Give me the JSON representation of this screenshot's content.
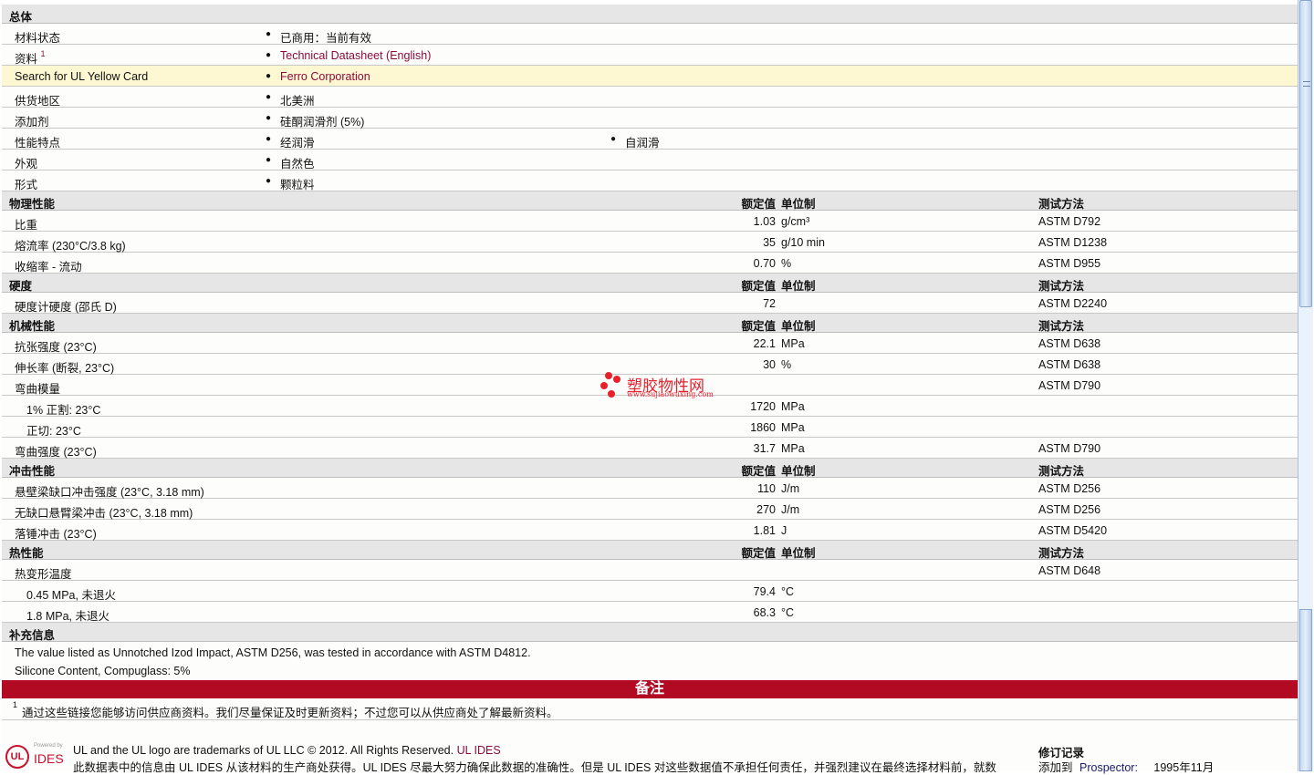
{
  "general": {
    "title": "总体",
    "rows": [
      {
        "label": "材料状态",
        "values": [
          "已商用：当前有效"
        ]
      },
      {
        "label": "资料",
        "sup": "1",
        "values": [
          "Technical Datasheet (English)"
        ],
        "link": true
      },
      {
        "label": "Search for UL Yellow Card",
        "values": [
          "Ferro Corporation"
        ],
        "link": true,
        "highlight": true
      },
      {
        "label": "供货地区",
        "values": [
          "北美洲"
        ]
      },
      {
        "label": "添加剂",
        "values": [
          "硅酮润滑剂 (5%)"
        ]
      },
      {
        "label": "性能特点",
        "values": [
          "经润滑",
          "自润滑"
        ]
      },
      {
        "label": "外观",
        "values": [
          "自然色"
        ]
      },
      {
        "label": "形式",
        "values": [
          "颗粒料"
        ]
      }
    ]
  },
  "col_headers": {
    "value": "额定值",
    "unit": "单位制",
    "method": "测试方法"
  },
  "sections": [
    {
      "title": "物理性能",
      "rows": [
        {
          "label": "比重",
          "value": "1.03",
          "unit": "g/cm³",
          "method": "ASTM D792"
        },
        {
          "label": "熔流率 (230°C/3.8 kg)",
          "value": "35",
          "unit": "g/10 min",
          "method": "ASTM D1238"
        },
        {
          "label": "收缩率 - 流动",
          "value": "0.70",
          "unit": "%",
          "method": "ASTM D955"
        }
      ]
    },
    {
      "title": "硬度",
      "rows": [
        {
          "label": "硬度计硬度 (邵氏 D)",
          "value": "72",
          "unit": "",
          "method": "ASTM D2240"
        }
      ]
    },
    {
      "title": "机械性能",
      "rows": [
        {
          "label": "抗张强度 (23°C)",
          "value": "22.1",
          "unit": "MPa",
          "method": "ASTM D638"
        },
        {
          "label": "伸长率 (断裂, 23°C)",
          "value": "30",
          "unit": "%",
          "method": "ASTM D638"
        },
        {
          "label": "弯曲模量",
          "value": "",
          "unit": "",
          "method": "ASTM D790"
        },
        {
          "label": "1% 正割: 23°C",
          "indent": true,
          "value": "1720",
          "unit": "MPa",
          "method": ""
        },
        {
          "label": "正切: 23°C",
          "indent": true,
          "value": "1860",
          "unit": "MPa",
          "method": ""
        },
        {
          "label": "弯曲强度 (23°C)",
          "value": "31.7",
          "unit": "MPa",
          "method": "ASTM D790"
        }
      ]
    },
    {
      "title": "冲击性能",
      "rows": [
        {
          "label": "悬壁梁缺口冲击强度 (23°C, 3.18 mm)",
          "value": "110",
          "unit": "J/m",
          "method": "ASTM D256"
        },
        {
          "label": "无缺口悬臂梁冲击 (23°C, 3.18 mm)",
          "value": "270",
          "unit": "J/m",
          "method": "ASTM D256"
        },
        {
          "label": "落锤冲击 (23°C)",
          "value": "1.81",
          "unit": "J",
          "method": "ASTM D5420"
        }
      ]
    },
    {
      "title": "热性能",
      "rows": [
        {
          "label": "热变形温度",
          "value": "",
          "unit": "",
          "method": "ASTM D648"
        },
        {
          "label": "0.45 MPa, 未退火",
          "indent": true,
          "value": "79.4",
          "unit": "°C",
          "method": ""
        },
        {
          "label": "1.8 MPa, 未退火",
          "indent": true,
          "value": "68.3",
          "unit": "°C",
          "method": ""
        }
      ]
    }
  ],
  "supplemental": {
    "title": "补充信息",
    "lines": [
      "The value listed as Unnotched Izod Impact, ASTM D256, was tested in accordance with ASTM D4812.",
      "Silicone Content, Compuglass: 5%"
    ]
  },
  "notes": {
    "title": "备注",
    "footnote_mark": "1",
    "footnote": "通过这些链接您能够访问供应商资料。我们尽量保证及时更新资料；不过您可以从供应商处了解最新资料。"
  },
  "watermark": {
    "name": "塑胶物性网",
    "url": "www.sujiaowuxing.com"
  },
  "footer": {
    "logo_powered": "Powered by",
    "logo_ul": "UL",
    "logo_ides": "IDES",
    "trademark": "UL and the UL logo are trademarks of UL LLC © 2012. All Rights Reserved.",
    "trademark_link": "UL IDES",
    "disclaimer": "此数据表中的信息由 UL IDES 从该材料的生产商处获得。UL IDES 尽最大努力确保此数据的准确性。但是 UL IDES 对这些数据值不承担任何责任，并强烈建议在最终选择材料前，就数",
    "revision_title": "修订记录",
    "revision_label": "添加到",
    "revision_link": "Prospector:",
    "revision_date": "1995年11月"
  },
  "colors": {
    "accent": "#b30a24",
    "link": "#8b0a3c",
    "highlight": "#fdf8d2",
    "section_bg": "#e6e6e6"
  }
}
